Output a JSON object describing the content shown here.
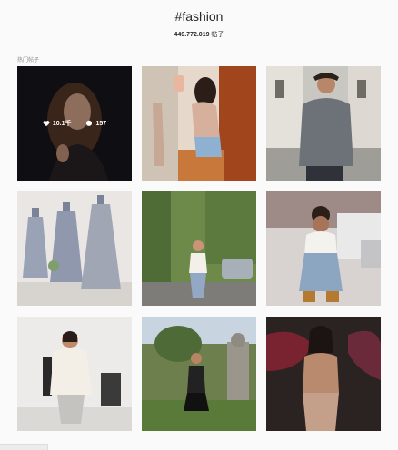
{
  "header": {
    "hashtag": "#fashion",
    "post_count": "449.772.019",
    "post_count_suffix": " 帖子"
  },
  "section": {
    "label": "热门帖子"
  },
  "top_post_stats": {
    "likes": "10.1千",
    "comments": "157"
  },
  "posts": [
    {
      "subject": "woman portrait dark background"
    },
    {
      "subject": "mirror selfie denim shorts"
    },
    {
      "subject": "man grey sweater street"
    },
    {
      "subject": "grey tulle dresses on mannequins"
    },
    {
      "subject": "woman street white top jeans"
    },
    {
      "subject": "child denim overalls"
    },
    {
      "subject": "woman white sweater metallic skirt"
    },
    {
      "subject": "woman black dress garden"
    },
    {
      "subject": "woman nude bodysuit neon sign"
    }
  ]
}
